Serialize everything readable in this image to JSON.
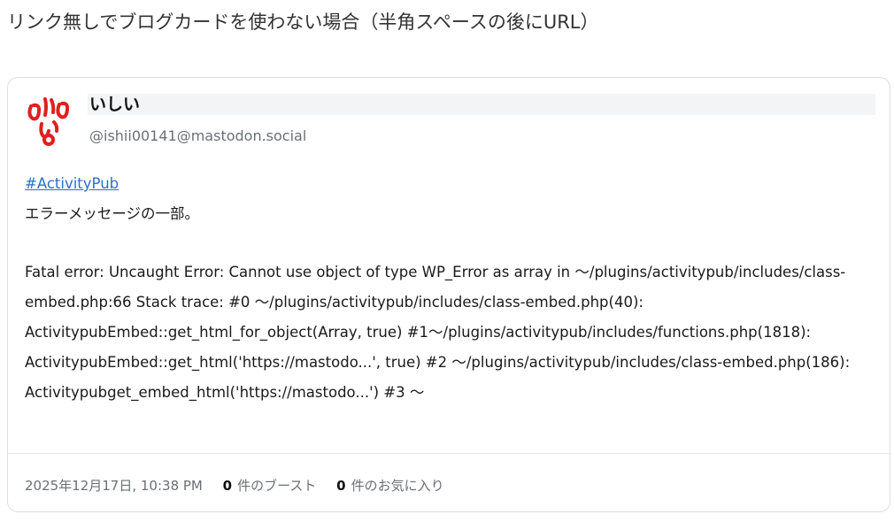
{
  "page": {
    "heading": "リンク無しでブログカードを使わない場合（半角スペースの後にURL）"
  },
  "post": {
    "author": {
      "display_name": "いしい",
      "handle": "@ishii00141@mastodon.social"
    },
    "hashtag": "#ActivityPub",
    "intro": "エラーメッセージの一部。",
    "error_lines": [
      "Fatal error: Uncaught Error: Cannot use object of type WP_Error as array in 〜/plugins/activitypub/includes/class-",
      "embed.php:66 Stack trace: #0 〜/plugins/activitypub/includes/class-embed.php(40):",
      "ActivitypubEmbed::get_html_for_object(Array, true) #1〜/plugins/activitypub/includes/functions.php(1818):",
      "ActivitypubEmbed::get_html('https://mastodo...', true) #2 〜/plugins/activitypub/includes/class-embed.php(186):",
      "Activitypubget_embed_html('https://mastodo...') #3 〜"
    ],
    "footer": {
      "timestamp": "2025年12月17日, 10:38 PM",
      "boosts_count": "0",
      "boosts_label": "件のブースト",
      "favourites_count": "0",
      "favourites_label": "件のお気に入り"
    }
  },
  "colors": {
    "link": "#2a6fd1",
    "muted": "#6b6f75",
    "avatar_red": "#e0201e"
  }
}
